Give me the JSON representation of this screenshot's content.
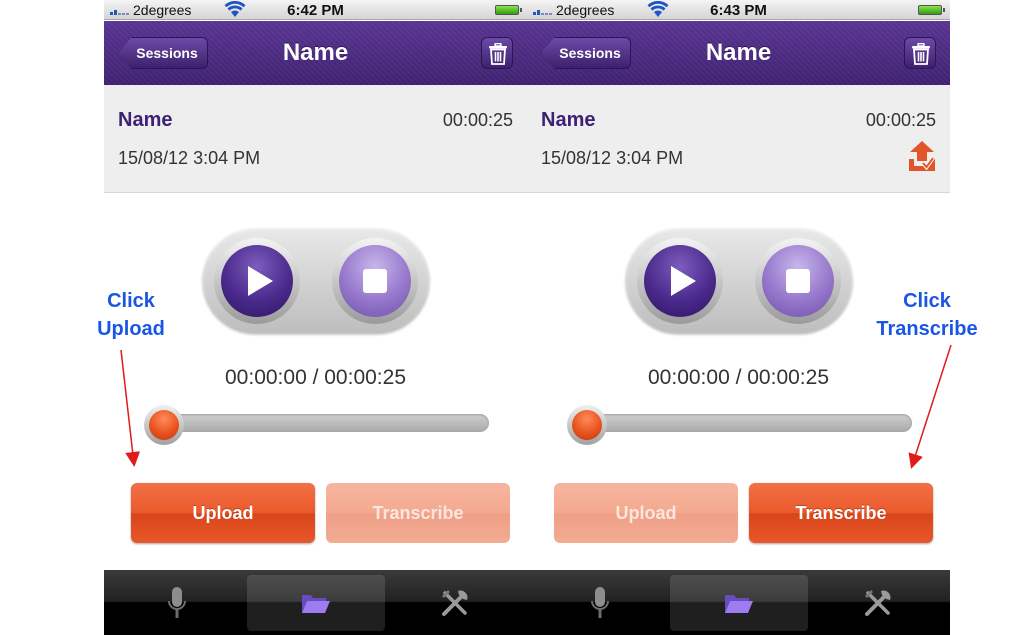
{
  "screens": [
    {
      "status_bar": {
        "carrier": "2degrees",
        "time": "6:42 PM"
      },
      "nav": {
        "back_label": "Sessions",
        "title": "Name"
      },
      "session": {
        "name": "Name",
        "date": "15/08/12 3:04 PM",
        "duration": "00:00:25",
        "uploaded_icon": false
      },
      "player": {
        "time_readout": "00:00:00 / 00:00:25",
        "progress": 0
      },
      "actions": {
        "upload_label": "Upload",
        "transcribe_label": "Transcribe",
        "active": "upload"
      }
    },
    {
      "status_bar": {
        "carrier": "2degrees",
        "time": "6:43 PM"
      },
      "nav": {
        "back_label": "Sessions",
        "title": "Name"
      },
      "session": {
        "name": "Name",
        "date": "15/08/12 3:04 PM",
        "duration": "",
        "uploaded_icon": true
      },
      "player": {
        "time_readout": "00:00:00 / 00:00:25",
        "progress": 0
      },
      "actions": {
        "upload_label": "Upload",
        "transcribe_label": "Transcribe",
        "active": "transcribe"
      }
    }
  ],
  "annotations": {
    "left": [
      "Click",
      "Upload"
    ],
    "right": [
      "Click",
      "Transcribe"
    ]
  },
  "tabs": [
    {
      "icon": "microphone-icon"
    },
    {
      "icon": "folder-icon",
      "selected": true
    },
    {
      "icon": "tools-icon"
    }
  ],
  "colors": {
    "nav_purple": "#4c2b84",
    "accent_orange": "#ea5a2b",
    "annotation_blue": "#1a56e6",
    "arrow_red": "#e01b1b"
  }
}
